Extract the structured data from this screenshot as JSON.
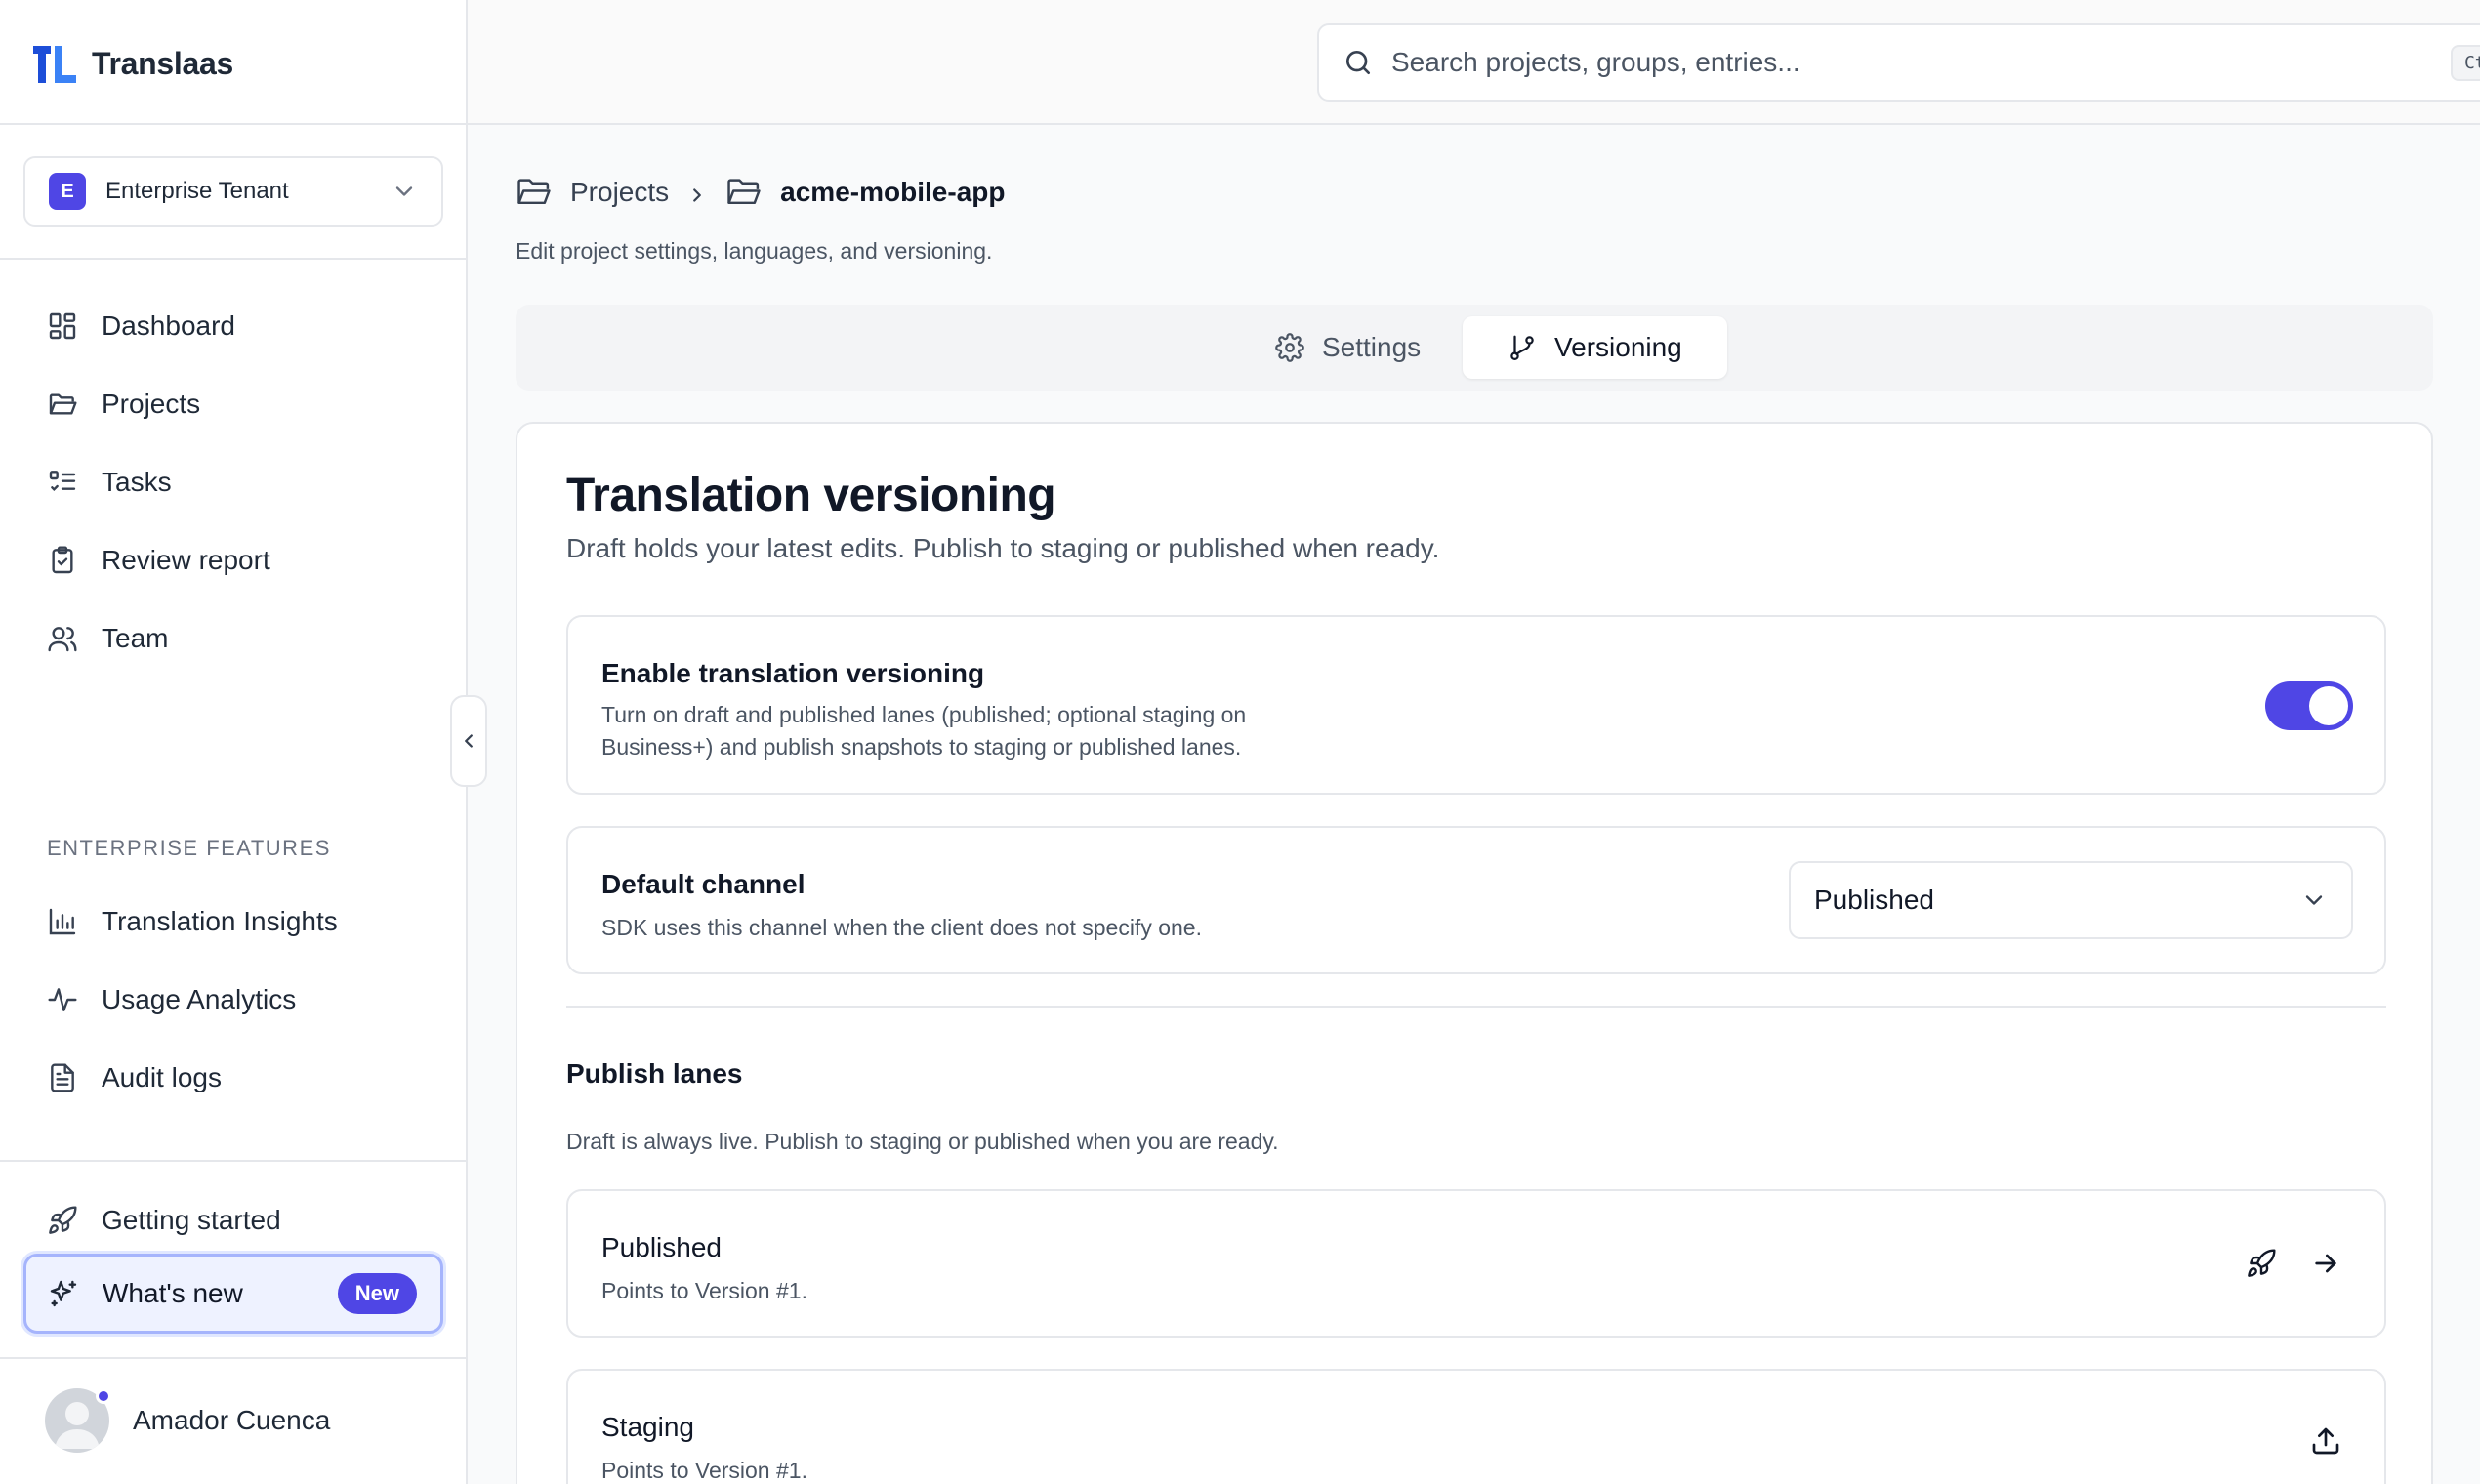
{
  "app": {
    "name": "Translaas"
  },
  "tenant": {
    "initial": "E",
    "name": "Enterprise Tenant"
  },
  "sidebar": {
    "items": [
      {
        "label": "Dashboard",
        "icon": "dashboard-icon"
      },
      {
        "label": "Projects",
        "icon": "folder-icon"
      },
      {
        "label": "Tasks",
        "icon": "tasks-icon"
      },
      {
        "label": "Review report",
        "icon": "clipboard-check-icon"
      },
      {
        "label": "Team",
        "icon": "users-icon"
      }
    ],
    "enterprise_label": "ENTERPRISE FEATURES",
    "enterprise_items": [
      {
        "label": "Translation Insights",
        "icon": "bar-chart-icon"
      },
      {
        "label": "Usage Analytics",
        "icon": "activity-icon"
      },
      {
        "label": "Audit logs",
        "icon": "file-text-icon"
      }
    ],
    "getting_started": "Getting started",
    "whats_new": "What's new",
    "new_badge": "New",
    "user_name": "Amador Cuenca"
  },
  "search": {
    "placeholder": "Search projects, groups, entries...",
    "shortcut": "Ctrl K"
  },
  "breadcrumb": {
    "root": "Projects",
    "current": "acme-mobile-app"
  },
  "page": {
    "subtitle": "Edit project settings, languages, and versioning."
  },
  "tabs": [
    {
      "label": "Settings",
      "icon": "gear-icon",
      "active": false
    },
    {
      "label": "Versioning",
      "icon": "git-branch-icon",
      "active": true
    }
  ],
  "versioning": {
    "title": "Translation versioning",
    "subtitle": "Draft holds your latest edits. Publish to staging or published when ready.",
    "enable": {
      "title": "Enable translation versioning",
      "desc_line1": "Turn on draft and published lanes (published; optional staging on",
      "desc_line2": "Business+) and publish snapshots to staging or published lanes.",
      "enabled": true
    },
    "default_channel": {
      "title": "Default channel",
      "desc": "SDK uses this channel when the client does not specify one.",
      "value": "Published"
    },
    "lanes_title": "Publish lanes",
    "lanes_desc": "Draft is always live. Publish to staging or published when you are ready.",
    "lanes": [
      {
        "name": "Published",
        "desc": "Points to Version #1."
      },
      {
        "name": "Staging",
        "desc": "Points to Version #1."
      }
    ]
  },
  "colors": {
    "accent": "#4f46e5",
    "border": "#e5e7eb",
    "muted_text": "#4b5563"
  }
}
